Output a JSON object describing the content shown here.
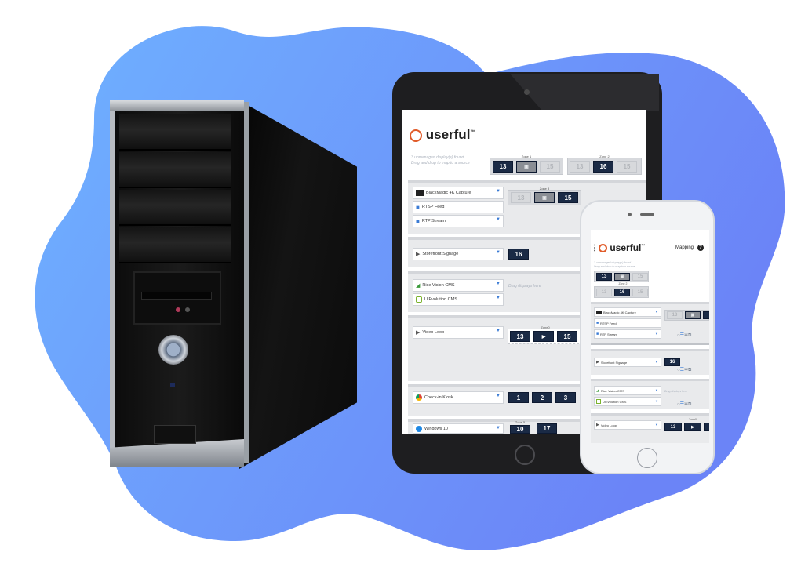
{
  "background": {
    "blob_color": "#6fa2ff",
    "blob_color_2": "#6b86f8"
  },
  "tablet": {
    "logo_text": "userful",
    "logo_tm": "™",
    "hint_line1": "3 unmanaged display(s) found.",
    "hint_line2": "Drag and drop to map to a source",
    "top_zone1_label": "Zone 1",
    "top_zone2_label": "Zone 2",
    "top_tiles": [
      "13",
      "▣",
      "15",
      "13",
      "16",
      "15"
    ],
    "sources": {
      "blackmagic": "BlackMagic 4K Capture",
      "rtsp": "RTSP Feed",
      "rtp": "RTP Stream",
      "storefront": "Storefront Signage",
      "rise": "Rise Vision CMS",
      "uievolution": "UIEvolution CMS",
      "video_loop": "Video Loop",
      "checkin": "Check-in Kiosk",
      "windows": "Windows 10"
    },
    "zone3_label": "Zone 3",
    "zone3_tiles": [
      "13",
      "▣",
      "15"
    ],
    "storefront_tile": "16",
    "drag_placeholder": "Drag displays here",
    "zone0_label": "Zone0",
    "zone0_tiles": [
      "13",
      "▶",
      "15"
    ],
    "checkin_tiles": [
      "1",
      "2",
      "3"
    ],
    "zone5_label": "Zone 5",
    "windows_tiles": [
      "10",
      "17"
    ]
  },
  "phone": {
    "logo_text": "userful",
    "logo_tm": "™",
    "menu_icon": "⋮",
    "mapping_label": "Mapping",
    "help_icon": "?",
    "hint_line1": "3 unmanaged display(s) found.",
    "hint_line2": "Drag and drop to map to a source",
    "top_tiles": [
      "13",
      "▣",
      "15",
      "13",
      "16",
      "15"
    ],
    "zone_label": "Zone 2",
    "sources": {
      "blackmagic": "BlackMagic 4K Capture",
      "rtsp": "RTSP Feed",
      "rtp": "RTP Stream",
      "storefront": "Storefront Signage",
      "rise": "Rise Vision CMS",
      "uievolution": "UIEvolution CMS",
      "video_loop": "Video Loop"
    },
    "zone3_tiles": [
      "13",
      "▣"
    ],
    "storefront_tile": "16",
    "drag_placeholder": "Drag displays here",
    "zone0_label": "Zone0",
    "zone0_tiles": [
      "13",
      "▶"
    ]
  }
}
